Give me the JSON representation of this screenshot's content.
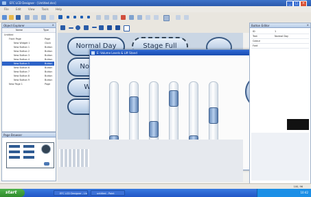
{
  "app": {
    "title": "EFC LCD Designer - [Untitled.dsn]"
  },
  "menu": [
    "File",
    "Edit",
    "View",
    "Tools",
    "Help"
  ],
  "explorer": {
    "title": "Object Explorer",
    "columns": [
      "Name",
      "Type"
    ],
    "rows": [
      {
        "name": "Untitled",
        "type": "",
        "indent": 0
      },
      {
        "name": "Front Page",
        "type": "Page",
        "indent": 1
      },
      {
        "name": "New Widget 1",
        "type": "Clock",
        "indent": 2
      },
      {
        "name": "New Button 1",
        "type": "Button",
        "indent": 2
      },
      {
        "name": "New Button 2",
        "type": "Button",
        "indent": 2
      },
      {
        "name": "New Button 3",
        "type": "Button",
        "indent": 2
      },
      {
        "name": "New Button 4",
        "type": "Button",
        "indent": 2
      },
      {
        "name": "New Button 5",
        "type": "Button",
        "indent": 2,
        "selected": true
      },
      {
        "name": "New Button 6",
        "type": "Button",
        "indent": 2
      },
      {
        "name": "New Button 7",
        "type": "Button",
        "indent": 2
      },
      {
        "name": "New Button 8",
        "type": "Button",
        "indent": 2
      },
      {
        "name": "New Button 9",
        "type": "Button",
        "indent": 2
      },
      {
        "name": "New Page 1",
        "type": "Page",
        "indent": 1
      }
    ]
  },
  "canvas": {
    "buttons": [
      "Normal Day",
      "Stage Full",
      "Norm",
      "We"
    ]
  },
  "dialog": {
    "title": "E: Volume Levels & Lift Stand",
    "next_label": ">",
    "sliders": [
      0.05,
      0.75,
      0.3,
      0.85,
      0.05,
      0.55
    ]
  },
  "properties": {
    "title": "Button Editor",
    "rows": [
      {
        "name": "ID",
        "value": "1"
      },
      {
        "name": "Text",
        "value": "Normal Day"
      },
      {
        "name": "Colour",
        "value": ""
      },
      {
        "name": "Font",
        "value": ""
      }
    ]
  },
  "page_browser": {
    "title": "Page Browser"
  },
  "status": {
    "coords": "100, 96"
  },
  "taskbar": {
    "start": "start",
    "tasks": [
      "EFC LCD Designer - Un...",
      "untitled - Paint"
    ],
    "clock": "10:42"
  }
}
